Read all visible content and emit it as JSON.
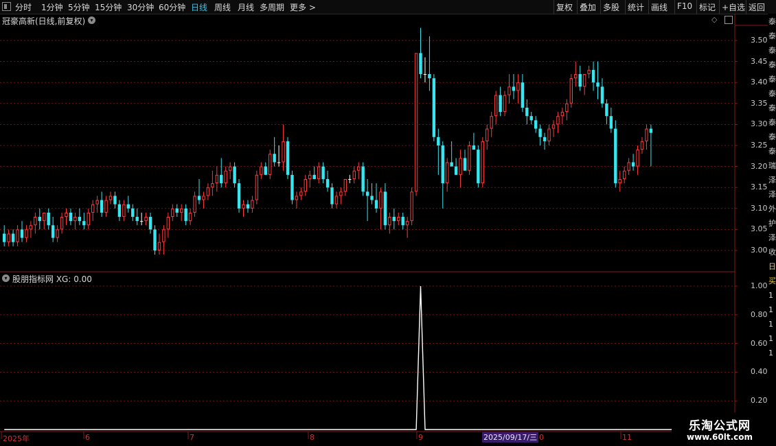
{
  "toolbar": {
    "periods": [
      "分时",
      "1分钟",
      "5分钟",
      "15分钟",
      "30分钟",
      "60分钟",
      "日线",
      "周线",
      "月线",
      "多周期",
      "更多 >"
    ],
    "active": "日线",
    "right_buttons": [
      "复权",
      "叠加",
      "多股",
      "统计",
      "画线",
      "F10",
      "标记",
      "+自选",
      "返回"
    ]
  },
  "main_chart": {
    "title": "冠豪高新(日线,前复权)",
    "ylim": [
      2.97,
      3.53
    ],
    "y_ticks": [
      "3.50",
      "3.45",
      "3.40",
      "3.35",
      "3.30",
      "3.25",
      "3.20",
      "3.15",
      "3.10",
      "3.05",
      "3.00"
    ]
  },
  "indicator": {
    "title": "股朋指标网  XG: 0.00",
    "y_ticks": [
      "1.00",
      "0.80",
      "0.60",
      "0.40",
      "0.20"
    ]
  },
  "date_axis": {
    "labels": [
      "2025年",
      "6",
      "7",
      "8",
      "9",
      "10",
      "11"
    ],
    "cursor_date": "2025/09/17/三"
  },
  "side_strip": {
    "chars": [
      "泰",
      "泰",
      "泰",
      "泰",
      "泰",
      "泰",
      "泰",
      "泰",
      "泰",
      "泰",
      "瑞",
      "泽",
      "泽",
      "外",
      "护",
      "泽",
      "收",
      "日",
      "买",
      "1",
      "1",
      "1",
      "1",
      "1"
    ]
  },
  "watermark": {
    "line1": "乐淘公式网",
    "line2": "www.60lt.com"
  },
  "colors": {
    "up": "#ff3b3b",
    "down": "#36e6f0",
    "flat": "#ffffff",
    "grid": "#7a1414",
    "axis": "#8a1818"
  },
  "chart_data": {
    "type": "candlestick",
    "title": "冠豪高新(日线,前复权)",
    "candles": [
      [
        3.04,
        3.06,
        3.01,
        3.02
      ],
      [
        3.02,
        3.05,
        3.01,
        3.04
      ],
      [
        3.04,
        3.05,
        3.01,
        3.02
      ],
      [
        3.02,
        3.06,
        3.01,
        3.05
      ],
      [
        3.05,
        3.07,
        3.02,
        3.03
      ],
      [
        3.03,
        3.06,
        3.02,
        3.05
      ],
      [
        3.05,
        3.07,
        3.03,
        3.06
      ],
      [
        3.06,
        3.09,
        3.04,
        3.08
      ],
      [
        3.08,
        3.1,
        3.05,
        3.07
      ],
      [
        3.07,
        3.09,
        3.05,
        3.09
      ],
      [
        3.09,
        3.1,
        3.05,
        3.06
      ],
      [
        3.06,
        3.08,
        3.02,
        3.03
      ],
      [
        3.03,
        3.06,
        3.02,
        3.05
      ],
      [
        3.05,
        3.09,
        3.04,
        3.08
      ],
      [
        3.08,
        3.1,
        3.06,
        3.09
      ],
      [
        3.09,
        3.1,
        3.06,
        3.07
      ],
      [
        3.07,
        3.09,
        3.05,
        3.08
      ],
      [
        3.08,
        3.1,
        3.06,
        3.07
      ],
      [
        3.07,
        3.09,
        3.05,
        3.06
      ],
      [
        3.06,
        3.1,
        3.05,
        3.09
      ],
      [
        3.09,
        3.12,
        3.07,
        3.11
      ],
      [
        3.11,
        3.13,
        3.09,
        3.12
      ],
      [
        3.12,
        3.14,
        3.08,
        3.09
      ],
      [
        3.09,
        3.13,
        3.08,
        3.12
      ],
      [
        3.12,
        3.14,
        3.11,
        3.13
      ],
      [
        3.13,
        3.14,
        3.1,
        3.11
      ],
      [
        3.11,
        3.12,
        3.07,
        3.08
      ],
      [
        3.08,
        3.12,
        3.07,
        3.11
      ],
      [
        3.11,
        3.13,
        3.09,
        3.1
      ],
      [
        3.1,
        3.11,
        3.07,
        3.08
      ],
      [
        3.08,
        3.1,
        3.06,
        3.07
      ],
      [
        3.07,
        3.09,
        3.06,
        3.07
      ],
      [
        3.07,
        3.09,
        3.06,
        3.08
      ],
      [
        3.08,
        3.09,
        3.04,
        3.05
      ],
      [
        3.05,
        3.06,
        2.99,
        3.0
      ],
      [
        3.0,
        3.04,
        2.99,
        3.02
      ],
      [
        3.02,
        3.06,
        2.99,
        3.05
      ],
      [
        3.05,
        3.09,
        3.03,
        3.08
      ],
      [
        3.08,
        3.11,
        3.07,
        3.1
      ],
      [
        3.1,
        3.11,
        3.08,
        3.09
      ],
      [
        3.09,
        3.11,
        3.07,
        3.1
      ],
      [
        3.1,
        3.11,
        3.06,
        3.07
      ],
      [
        3.07,
        3.1,
        3.06,
        3.09
      ],
      [
        3.09,
        3.14,
        3.08,
        3.13
      ],
      [
        3.13,
        3.17,
        3.11,
        3.12
      ],
      [
        3.12,
        3.14,
        3.1,
        3.13
      ],
      [
        3.13,
        3.16,
        3.12,
        3.15
      ],
      [
        3.15,
        3.19,
        3.13,
        3.16
      ],
      [
        3.16,
        3.2,
        3.14,
        3.18
      ],
      [
        3.18,
        3.22,
        3.15,
        3.16
      ],
      [
        3.16,
        3.2,
        3.15,
        3.19
      ],
      [
        3.19,
        3.21,
        3.17,
        3.2
      ],
      [
        3.2,
        3.21,
        3.15,
        3.16
      ],
      [
        3.16,
        3.17,
        3.09,
        3.1
      ],
      [
        3.1,
        3.12,
        3.08,
        3.11
      ],
      [
        3.11,
        3.12,
        3.09,
        3.1
      ],
      [
        3.1,
        3.13,
        3.09,
        3.12
      ],
      [
        3.12,
        3.19,
        3.11,
        3.18
      ],
      [
        3.18,
        3.21,
        3.17,
        3.2
      ],
      [
        3.2,
        3.21,
        3.18,
        3.18
      ],
      [
        3.18,
        3.24,
        3.17,
        3.23
      ],
      [
        3.23,
        3.27,
        3.2,
        3.21
      ],
      [
        3.21,
        3.25,
        3.2,
        3.21
      ],
      [
        3.21,
        3.3,
        3.19,
        3.26
      ],
      [
        3.26,
        3.27,
        3.17,
        3.18
      ],
      [
        3.18,
        3.19,
        3.11,
        3.12
      ],
      [
        3.12,
        3.14,
        3.1,
        3.13
      ],
      [
        3.13,
        3.15,
        3.12,
        3.14
      ],
      [
        3.14,
        3.18,
        3.13,
        3.17
      ],
      [
        3.17,
        3.19,
        3.15,
        3.18
      ],
      [
        3.18,
        3.2,
        3.17,
        3.17
      ],
      [
        3.17,
        3.21,
        3.16,
        3.2
      ],
      [
        3.2,
        3.21,
        3.16,
        3.17
      ],
      [
        3.17,
        3.19,
        3.14,
        3.15
      ],
      [
        3.15,
        3.16,
        3.1,
        3.11
      ],
      [
        3.11,
        3.14,
        3.1,
        3.13
      ],
      [
        3.13,
        3.15,
        3.11,
        3.14
      ],
      [
        3.14,
        3.17,
        3.13,
        3.17
      ],
      [
        3.17,
        3.18,
        3.16,
        3.17
      ],
      [
        3.17,
        3.2,
        3.16,
        3.19
      ],
      [
        3.19,
        3.21,
        3.17,
        3.2
      ],
      [
        3.2,
        3.21,
        3.13,
        3.14
      ],
      [
        3.14,
        3.17,
        3.07,
        3.13
      ],
      [
        3.13,
        3.16,
        3.11,
        3.12
      ],
      [
        3.12,
        3.16,
        3.09,
        3.1
      ],
      [
        3.1,
        3.15,
        3.05,
        3.14
      ],
      [
        3.14,
        3.16,
        3.05,
        3.06
      ],
      [
        3.06,
        3.09,
        3.04,
        3.08
      ],
      [
        3.08,
        3.1,
        3.05,
        3.07
      ],
      [
        3.07,
        3.09,
        3.06,
        3.08
      ],
      [
        3.08,
        3.09,
        3.05,
        3.06
      ],
      [
        3.06,
        3.08,
        3.03,
        3.07
      ],
      [
        3.07,
        3.15,
        3.06,
        3.14
      ],
      [
        3.14,
        3.47,
        3.13,
        3.47
      ],
      [
        3.47,
        3.53,
        3.41,
        3.42
      ],
      [
        3.42,
        3.46,
        3.4,
        3.42
      ],
      [
        3.42,
        3.51,
        3.38,
        3.41
      ],
      [
        3.41,
        3.42,
        3.26,
        3.27
      ],
      [
        3.27,
        3.29,
        3.18,
        3.25
      ],
      [
        3.25,
        3.26,
        3.1,
        3.16
      ],
      [
        3.16,
        3.22,
        3.14,
        3.21
      ],
      [
        3.21,
        3.26,
        3.2,
        3.2
      ],
      [
        3.2,
        3.22,
        3.18,
        3.18
      ],
      [
        3.18,
        3.24,
        3.15,
        3.22
      ],
      [
        3.22,
        3.24,
        3.19,
        3.19
      ],
      [
        3.19,
        3.26,
        3.18,
        3.25
      ],
      [
        3.25,
        3.28,
        3.24,
        3.24
      ],
      [
        3.24,
        3.25,
        3.15,
        3.16
      ],
      [
        3.16,
        3.27,
        3.15,
        3.26
      ],
      [
        3.26,
        3.3,
        3.24,
        3.29
      ],
      [
        3.29,
        3.33,
        3.27,
        3.32
      ],
      [
        3.32,
        3.38,
        3.3,
        3.37
      ],
      [
        3.37,
        3.39,
        3.32,
        3.33
      ],
      [
        3.33,
        3.38,
        3.32,
        3.37
      ],
      [
        3.37,
        3.42,
        3.35,
        3.39
      ],
      [
        3.39,
        3.42,
        3.36,
        3.38
      ],
      [
        3.38,
        3.42,
        3.35,
        3.4
      ],
      [
        3.4,
        3.42,
        3.33,
        3.34
      ],
      [
        3.34,
        3.36,
        3.3,
        3.32
      ],
      [
        3.32,
        3.33,
        3.3,
        3.31
      ],
      [
        3.31,
        3.32,
        3.28,
        3.29
      ],
      [
        3.29,
        3.3,
        3.25,
        3.27
      ],
      [
        3.27,
        3.28,
        3.24,
        3.26
      ],
      [
        3.26,
        3.3,
        3.25,
        3.29
      ],
      [
        3.29,
        3.31,
        3.27,
        3.3
      ],
      [
        3.3,
        3.33,
        3.28,
        3.32
      ],
      [
        3.32,
        3.34,
        3.3,
        3.33
      ],
      [
        3.33,
        3.36,
        3.31,
        3.35
      ],
      [
        3.35,
        3.42,
        3.34,
        3.41
      ],
      [
        3.41,
        3.45,
        3.39,
        3.42
      ],
      [
        3.42,
        3.44,
        3.38,
        3.39
      ],
      [
        3.39,
        3.42,
        3.37,
        3.42
      ],
      [
        3.42,
        3.44,
        3.41,
        3.43
      ],
      [
        3.43,
        3.45,
        3.38,
        3.4
      ],
      [
        3.4,
        3.45,
        3.36,
        3.39
      ],
      [
        3.39,
        3.41,
        3.34,
        3.35
      ],
      [
        3.35,
        3.36,
        3.3,
        3.32
      ],
      [
        3.32,
        3.34,
        3.28,
        3.29
      ],
      [
        3.29,
        3.31,
        3.15,
        3.16
      ],
      [
        3.16,
        3.19,
        3.14,
        3.17
      ],
      [
        3.17,
        3.2,
        3.16,
        3.19
      ],
      [
        3.19,
        3.22,
        3.18,
        3.21
      ],
      [
        3.21,
        3.23,
        3.19,
        3.2
      ],
      [
        3.2,
        3.25,
        3.18,
        3.24
      ],
      [
        3.24,
        3.27,
        3.23,
        3.26
      ],
      [
        3.26,
        3.3,
        3.24,
        3.29
      ],
      [
        3.29,
        3.3,
        3.2,
        3.28
      ]
    ],
    "xg_signal": {
      "peak_index": 94,
      "peak_value": 1.0,
      "base_value": 0.0
    }
  }
}
